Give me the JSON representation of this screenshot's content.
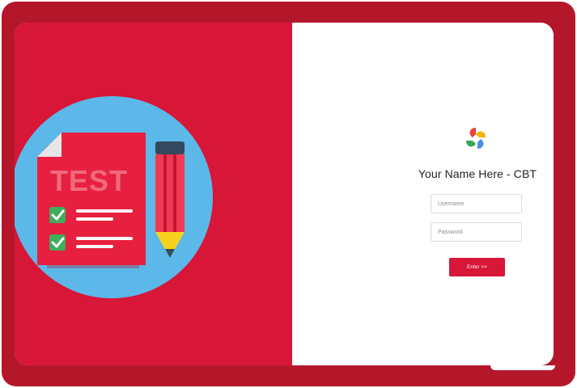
{
  "illustration": {
    "doc_label": "TEST",
    "icons": [
      "test-document-icon",
      "checkbox-checked-icon",
      "pencil-icon"
    ]
  },
  "login": {
    "logo_icon": "pinwheel-logo-icon",
    "title": "Your Name Here - CBT",
    "username_placeholder": "Username",
    "password_placeholder": "Password",
    "enter_label": "Enter >>"
  },
  "colors": {
    "frame": "#b5172a",
    "brand_red": "#d81638",
    "circle_blue": "#5bb8e8",
    "check_green": "#3fae5a",
    "pencil_yellow": "#f6d21e",
    "pencil_dark": "#34495e"
  }
}
